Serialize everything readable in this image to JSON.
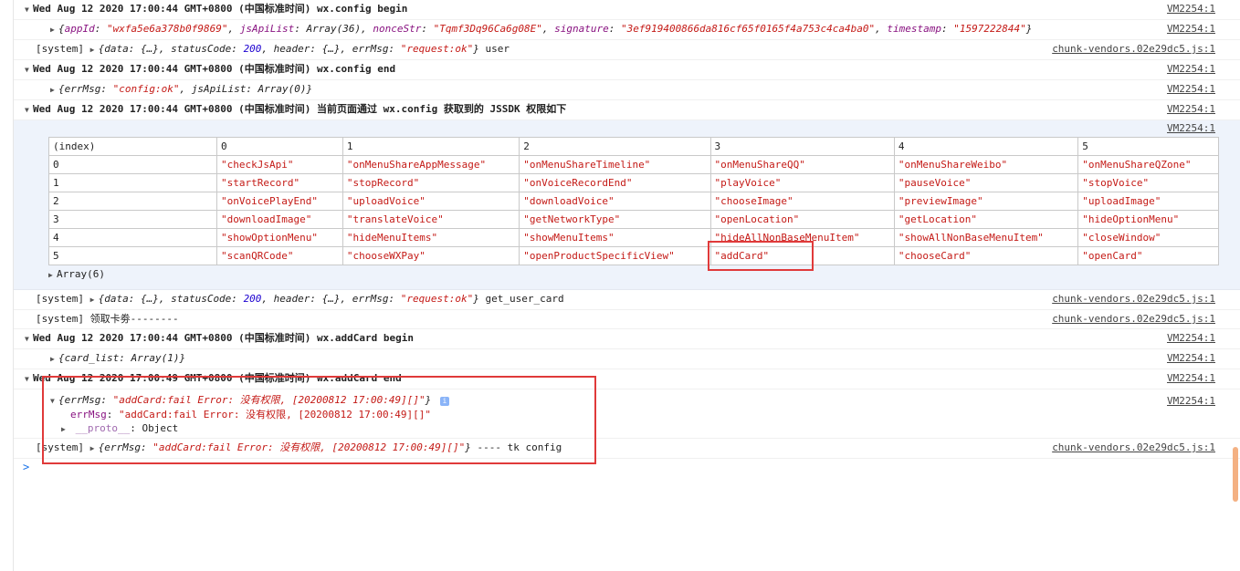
{
  "logs": [
    {
      "id": "l1",
      "kind": "group",
      "text": "Wed Aug 12 2020 17:00:44 GMT+0800 (中国标准时间) wx.config begin",
      "source": "VM2254:1"
    },
    {
      "id": "l2",
      "kind": "obj",
      "prefix": "{",
      "parts": [
        [
          "key",
          "appId"
        ],
        [
          "p",
          ": "
        ],
        [
          "str",
          "\"wxfa5e6a378b0f9869\""
        ],
        [
          "p",
          ", "
        ],
        [
          "key",
          "jsApiList"
        ],
        [
          "p",
          ": Array(36), "
        ],
        [
          "key",
          "nonceStr"
        ],
        [
          "p",
          ": "
        ],
        [
          "str",
          "\"Tqmf3Dq96Ca6g08E\""
        ],
        [
          "p",
          ", "
        ],
        [
          "key",
          "signature"
        ],
        [
          "p",
          ": "
        ],
        [
          "str",
          "\"3ef919400866da816cf65f0165f4a753c4ca4ba0\""
        ],
        [
          "p",
          ", "
        ],
        [
          "key",
          "timestamp"
        ],
        [
          "p",
          ": "
        ],
        [
          "str",
          "\"1597222844\""
        ],
        [
          "p",
          "}"
        ]
      ],
      "source": "VM2254:1"
    },
    {
      "id": "l3",
      "kind": "system",
      "pre": "[system]",
      "parts": [
        [
          "p",
          "{data: {…}, statusCode: "
        ],
        [
          "num",
          "200"
        ],
        [
          "p",
          ", header: {…}, errMsg: "
        ],
        [
          "str",
          "\"request:ok\""
        ],
        [
          "p",
          "}"
        ]
      ],
      "suffix": "user",
      "source": "chunk-vendors.02e29dc5.js:1"
    },
    {
      "id": "l4",
      "kind": "group",
      "text": "Wed Aug 12 2020 17:00:44 GMT+0800 (中国标准时间) wx.config end",
      "source": "VM2254:1"
    },
    {
      "id": "l5",
      "kind": "obj",
      "parts": [
        [
          "p",
          "{errMsg: "
        ],
        [
          "str",
          "\"config:ok\""
        ],
        [
          "p",
          ", jsApiList: Array(0)}"
        ]
      ],
      "source": "VM2254:1"
    },
    {
      "id": "l6",
      "kind": "group",
      "text": "Wed Aug 12 2020 17:00:44 GMT+0800 (中国标准时间) 当前页面通过 wx.config 获取到的 JSSDK 权限如下",
      "source": "VM2254:1"
    }
  ],
  "table": {
    "source": "VM2254:1",
    "headers": [
      "(index)",
      "0",
      "1",
      "2",
      "3",
      "4",
      "5"
    ],
    "rows": [
      [
        "0",
        "\"checkJsApi\"",
        "\"onMenuShareAppMessage\"",
        "\"onMenuShareTimeline\"",
        "\"onMenuShareQQ\"",
        "\"onMenuShareWeibo\"",
        "\"onMenuShareQZone\""
      ],
      [
        "1",
        "\"startRecord\"",
        "\"stopRecord\"",
        "\"onVoiceRecordEnd\"",
        "\"playVoice\"",
        "\"pauseVoice\"",
        "\"stopVoice\""
      ],
      [
        "2",
        "\"onVoicePlayEnd\"",
        "\"uploadVoice\"",
        "\"downloadVoice\"",
        "\"chooseImage\"",
        "\"previewImage\"",
        "\"uploadImage\""
      ],
      [
        "3",
        "\"downloadImage\"",
        "\"translateVoice\"",
        "\"getNetworkType\"",
        "\"openLocation\"",
        "\"getLocation\"",
        "\"hideOptionMenu\""
      ],
      [
        "4",
        "\"showOptionMenu\"",
        "\"hideMenuItems\"",
        "\"showMenuItems\"",
        "\"hideAllNonBaseMenuItem\"",
        "\"showAllNonBaseMenuItem\"",
        "\"closeWindow\""
      ],
      [
        "5",
        "\"scanQRCode\"",
        "\"chooseWXPay\"",
        "\"openProductSpecificView\"",
        "\"addCard\"",
        "\"chooseCard\"",
        "\"openCard\""
      ]
    ],
    "footer": "Array(6)"
  },
  "logs2": [
    {
      "id": "m1",
      "kind": "system",
      "pre": "[system]",
      "parts": [
        [
          "p",
          "{data: {…}, statusCode: "
        ],
        [
          "num",
          "200"
        ],
        [
          "p",
          ", header: {…}, errMsg: "
        ],
        [
          "str",
          "\"request:ok\""
        ],
        [
          "p",
          "}"
        ]
      ],
      "suffix": "get_user_card",
      "source": "chunk-vendors.02e29dc5.js:1"
    },
    {
      "id": "m2",
      "kind": "plainsys",
      "text": "[system] 领取卡劵--------",
      "source": "chunk-vendors.02e29dc5.js:1"
    },
    {
      "id": "m3",
      "kind": "group",
      "text": "Wed Aug 12 2020 17:00:44 GMT+0800 (中国标准时间) wx.addCard begin",
      "source": "VM2254:1"
    },
    {
      "id": "m4",
      "kind": "obj",
      "parts": [
        [
          "p",
          "{card_list: Array(1)}"
        ]
      ],
      "source": "VM2254:1"
    },
    {
      "id": "m5",
      "kind": "group",
      "text": "Wed Aug 12 2020 17:00:49 GMT+0800 (中国标准时间) wx.addCard end",
      "source": "VM2254:1"
    }
  ],
  "error_obj": {
    "source": "VM2254:1",
    "summary_parts": [
      [
        "p",
        "{errMsg: "
      ],
      [
        "str",
        "\"addCard:fail Error: 没有权限, [20200812 17:00:49][]\""
      ],
      [
        "p",
        "}"
      ]
    ],
    "info_badge": "i",
    "prop_key": "errMsg",
    "prop_value": "\"addCard:fail Error: 没有权限, [20200812 17:00:49][]\"",
    "proto_key": "__proto__",
    "proto_value": "Object"
  },
  "final_sys": {
    "pre": "[system]",
    "parts": [
      [
        "p",
        "{errMsg: "
      ],
      [
        "str",
        "\"addCard:fail Error: 没有权限, [20200812 17:00:49][]\""
      ],
      [
        "p",
        "}"
      ]
    ],
    "suffix": "---- tk config",
    "source": "chunk-vendors.02e29dc5.js:1"
  },
  "prompt_symbol": ">"
}
